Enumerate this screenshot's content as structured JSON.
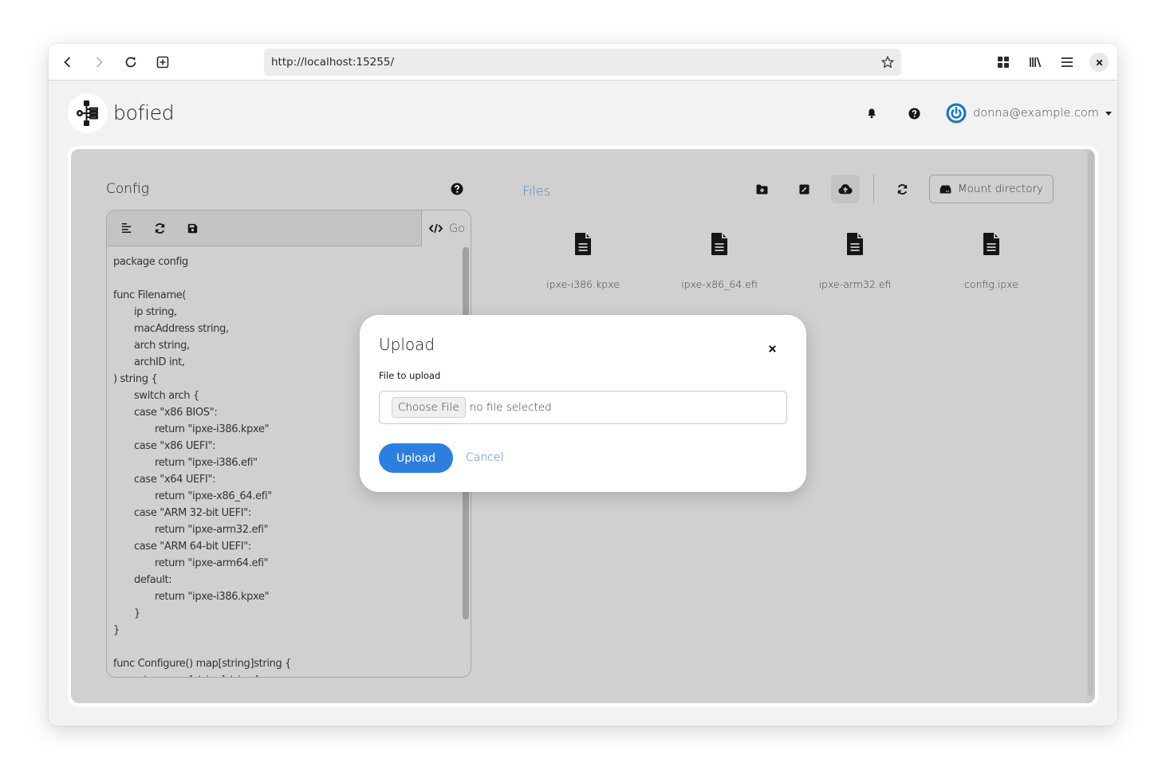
{
  "browser": {
    "url": "http://localhost:15255/",
    "icons": {
      "back": "chevron-left-icon",
      "forward": "chevron-right-icon",
      "reload": "reload-icon",
      "new_tab": "plus-square-icon",
      "bookmark": "star-icon",
      "apps": "grid-icon",
      "library": "library-icon",
      "menu": "hamburger-icon",
      "close": "close-icon"
    }
  },
  "header": {
    "brand": "bofied",
    "user": "donna@example.com",
    "icons": {
      "notifications": "bell-icon",
      "help": "question-circle-icon",
      "user_avatar": "power-icon",
      "user_menu": "caret-down-icon"
    }
  },
  "config": {
    "title": "Config",
    "language": "Go",
    "toolbar": {
      "format": "align-left-icon",
      "refresh": "sync-icon",
      "save": "save-icon",
      "language_icon": "code-icon"
    },
    "code_lines": [
      "package config",
      "",
      "func Filename(",
      "\tip string,",
      "\tmacAddress string,",
      "\tarch string,",
      "\tarchID int,",
      ") string {",
      "\tswitch arch {",
      "\tcase \"x86 BIOS\":",
      "\t\treturn \"ipxe-i386.kpxe\"",
      "\tcase \"x86 UEFI\":",
      "\t\treturn \"ipxe-i386.efi\"",
      "\tcase \"x64 UEFI\":",
      "\t\treturn \"ipxe-x86_64.efi\"",
      "\tcase \"ARM 32-bit UEFI\":",
      "\t\treturn \"ipxe-arm32.efi\"",
      "\tcase \"ARM 64-bit UEFI\":",
      "\t\treturn \"ipxe-arm64.efi\"",
      "\tdefault:",
      "\t\treturn \"ipxe-i386.kpxe\"",
      "\t}",
      "}",
      "",
      "func Configure() map[string]string {",
      "\treturn map[string]string{"
    ]
  },
  "files": {
    "title": "Files",
    "mount_label": "Mount directory",
    "toolbar": {
      "new_folder": "folder-plus-icon",
      "rename": "edit-icon",
      "upload": "cloud-upload-icon",
      "refresh": "sync-icon",
      "mount": "hdd-icon"
    },
    "items": [
      {
        "name": "ipxe-i386.kpxe"
      },
      {
        "name": "ipxe-x86_64.efi"
      },
      {
        "name": "ipxe-arm32.efi"
      },
      {
        "name": "config.ipxe"
      }
    ]
  },
  "modal": {
    "title": "Upload",
    "field_label": "File to upload",
    "choose_label": "Choose File",
    "file_status": "no file selected",
    "upload_label": "Upload",
    "cancel_label": "Cancel"
  },
  "colors": {
    "accent": "#2d7fde",
    "link": "#4a82c6",
    "panel_bg": "#d0d0d0"
  }
}
